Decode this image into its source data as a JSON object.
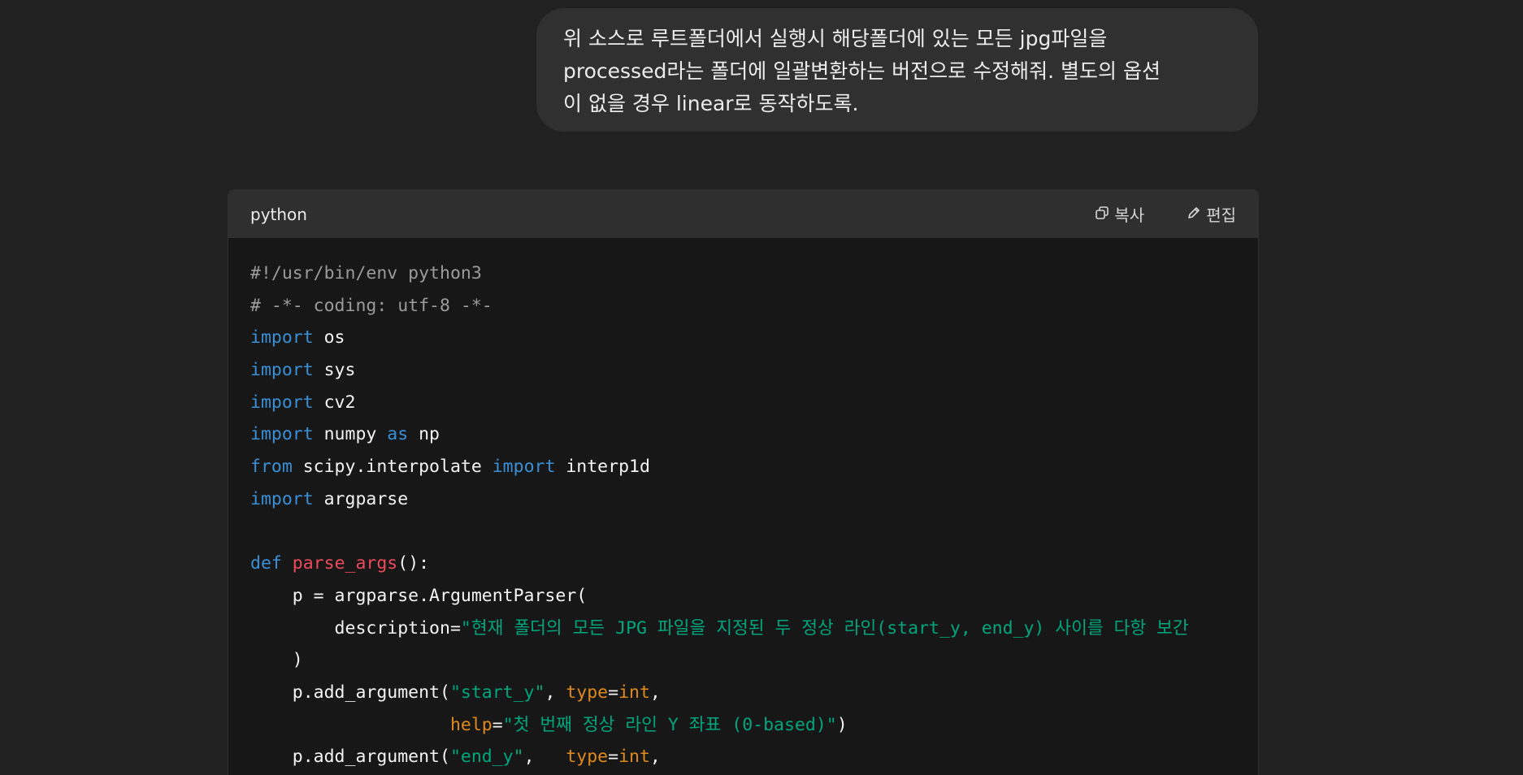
{
  "user_message": {
    "lines": [
      "위 소스로 루트폴더에서 실행시 해당폴더에 있는 모든 jpg파일을",
      "processed라는 폴더에 일괄변환하는 버전으로 수정해줘. 별도의 옵션",
      "이 없을 경우 linear로 동작하도록."
    ]
  },
  "code_block": {
    "language": "python",
    "copy_label": "복사",
    "edit_label": "편집",
    "icons": {
      "copy": "copy-icon",
      "edit": "pencil-icon"
    },
    "colors": {
      "comment": "#9b9b9b",
      "keyword": "#3a8fd6",
      "function": "#ef4a5b",
      "string": "#00a67d",
      "param": "#df8a1c",
      "plain": "#f4f4f4"
    },
    "lines": [
      [
        {
          "t": "#!/usr/bin/env python3",
          "c": "c"
        }
      ],
      [
        {
          "t": "# -*- coding: utf-8 -*-",
          "c": "c"
        }
      ],
      [
        {
          "t": "import",
          "c": "k"
        },
        {
          "t": " os",
          "c": "n"
        }
      ],
      [
        {
          "t": "import",
          "c": "k"
        },
        {
          "t": " sys",
          "c": "n"
        }
      ],
      [
        {
          "t": "import",
          "c": "k"
        },
        {
          "t": " cv2",
          "c": "n"
        }
      ],
      [
        {
          "t": "import",
          "c": "k"
        },
        {
          "t": " numpy ",
          "c": "n"
        },
        {
          "t": "as",
          "c": "k"
        },
        {
          "t": " np",
          "c": "n"
        }
      ],
      [
        {
          "t": "from",
          "c": "k"
        },
        {
          "t": " scipy.interpolate ",
          "c": "n"
        },
        {
          "t": "import",
          "c": "k"
        },
        {
          "t": " interp1d",
          "c": "n"
        }
      ],
      [
        {
          "t": "import",
          "c": "k"
        },
        {
          "t": " argparse",
          "c": "n"
        }
      ],
      [],
      [
        {
          "t": "def",
          "c": "k"
        },
        {
          "t": " ",
          "c": "n"
        },
        {
          "t": "parse_args",
          "c": "fn"
        },
        {
          "t": "():",
          "c": "n"
        }
      ],
      [
        {
          "t": "    p = argparse.ArgumentParser(",
          "c": "n"
        }
      ],
      [
        {
          "t": "        description=",
          "c": "n"
        },
        {
          "t": "\"현재 폴더의 모든 JPG 파일을 지정된 두 정상 라인(start_y, end_y) 사이를 다항 보간",
          "c": "s"
        }
      ],
      [
        {
          "t": "    )",
          "c": "n"
        }
      ],
      [
        {
          "t": "    p.add_argument(",
          "c": "n"
        },
        {
          "t": "\"start_y\"",
          "c": "s"
        },
        {
          "t": ", ",
          "c": "n"
        },
        {
          "t": "type",
          "c": "p"
        },
        {
          "t": "=",
          "c": "n"
        },
        {
          "t": "int",
          "c": "p"
        },
        {
          "t": ",",
          "c": "n"
        }
      ],
      [
        {
          "t": "                   ",
          "c": "n"
        },
        {
          "t": "help",
          "c": "p"
        },
        {
          "t": "=",
          "c": "n"
        },
        {
          "t": "\"첫 번째 정상 라인 Y 좌표 (0-based)\"",
          "c": "s"
        },
        {
          "t": ")",
          "c": "n"
        }
      ],
      [
        {
          "t": "    p.add_argument(",
          "c": "n"
        },
        {
          "t": "\"end_y\"",
          "c": "s"
        },
        {
          "t": ",   ",
          "c": "n"
        },
        {
          "t": "type",
          "c": "p"
        },
        {
          "t": "=",
          "c": "n"
        },
        {
          "t": "int",
          "c": "p"
        },
        {
          "t": ",",
          "c": "n"
        }
      ]
    ]
  }
}
